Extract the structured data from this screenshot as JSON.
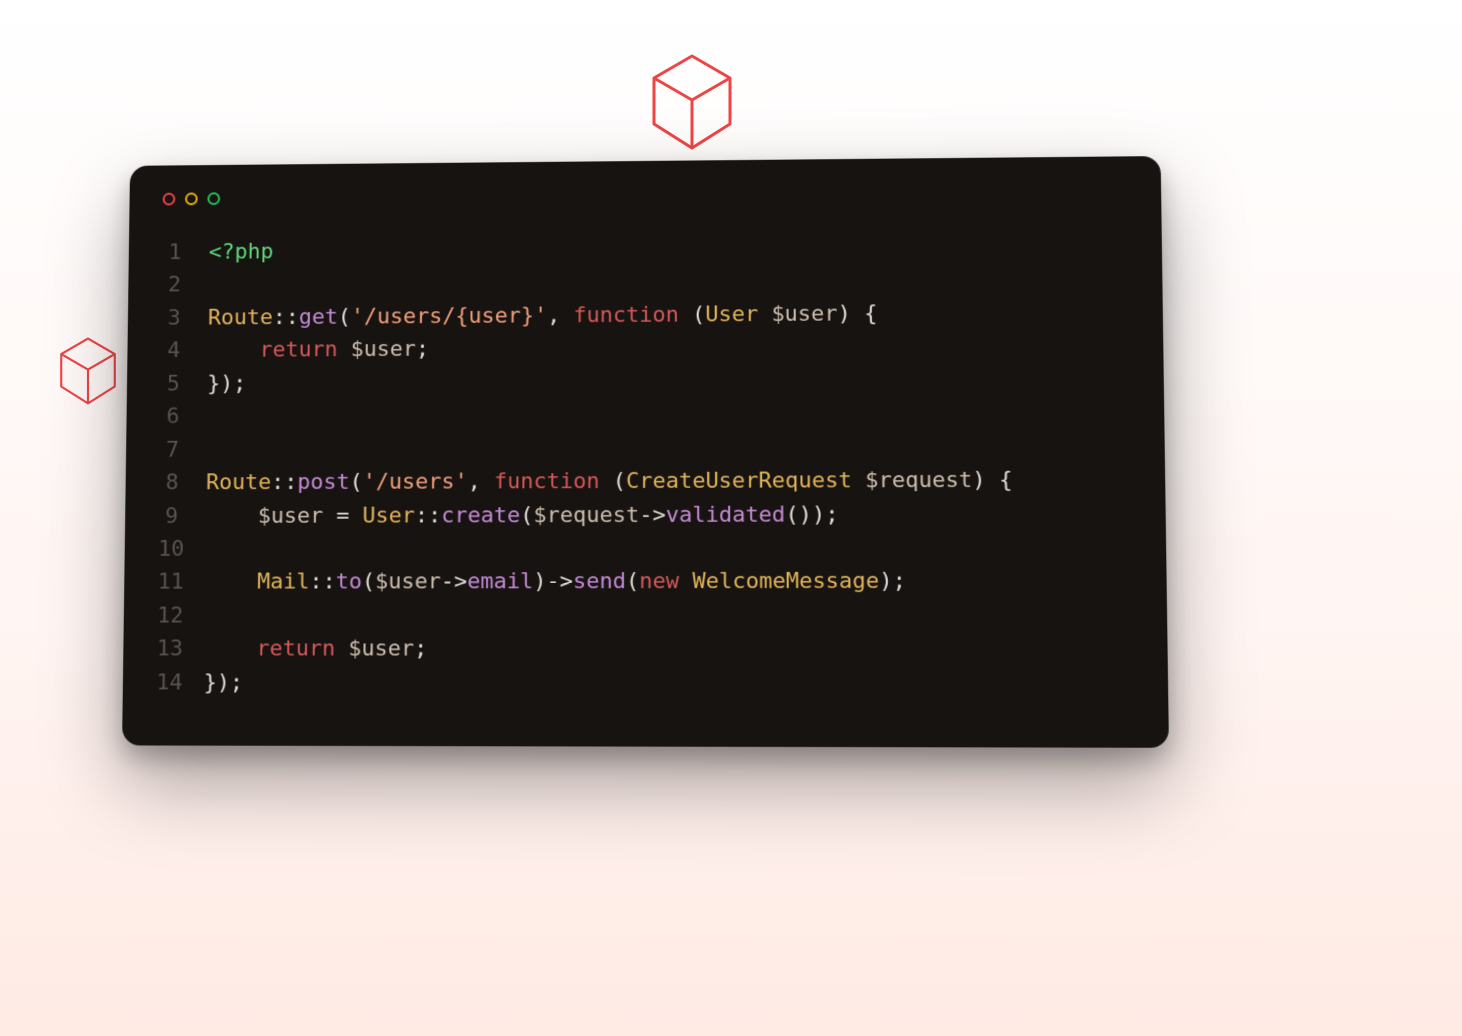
{
  "lines": {
    "n1": "1",
    "n2": "2",
    "n3": "3",
    "n4": "4",
    "n5": "5",
    "n6": "6",
    "n7": "7",
    "n8": "8",
    "n9": "9",
    "n10": "10",
    "n11": "11",
    "n12": "12",
    "n13": "13",
    "n14": "14"
  },
  "l1": {
    "php": "<?php"
  },
  "l3": {
    "route": "Route",
    "dcol": "::",
    "get": "get",
    "op": "(",
    "str": "'/users/{user}'",
    "cm": ", ",
    "fn": "function",
    "sp": " ",
    "op2": "(",
    "type": "User ",
    "var": "$user",
    "cp": ") {"
  },
  "l4": {
    "ind": "    ",
    "ret": "return",
    "sp": " ",
    "var": "$user",
    "sc": ";"
  },
  "l5": {
    "close": "});"
  },
  "l8": {
    "route": "Route",
    "dcol": "::",
    "post": "post",
    "op": "(",
    "str": "'/users'",
    "cm": ", ",
    "fn": "function",
    "sp": " ",
    "op2": "(",
    "type": "CreateUserRequest ",
    "var": "$request",
    "cp": ") {"
  },
  "l9": {
    "ind": "    ",
    "var": "$user",
    "eq": " = ",
    "user": "User",
    "dcol": "::",
    "create": "create",
    "op": "(",
    "req": "$request",
    "arrow": "->",
    "validated": "validated",
    "close": "());"
  },
  "l11": {
    "ind": "    ",
    "mail": "Mail",
    "dcol": "::",
    "to": "to",
    "op": "(",
    "usr": "$user",
    "arrow": "->",
    "email": "email",
    "cp": ")",
    "arrow2": "->",
    "send": "send",
    "op2": "(",
    "new": "new",
    "sp": " ",
    "wm": "WelcomeMessage",
    "close": ");"
  },
  "l13": {
    "ind": "    ",
    "ret": "return",
    "sp": " ",
    "var": "$user",
    "sc": ";"
  },
  "l14": {
    "close": "});"
  }
}
